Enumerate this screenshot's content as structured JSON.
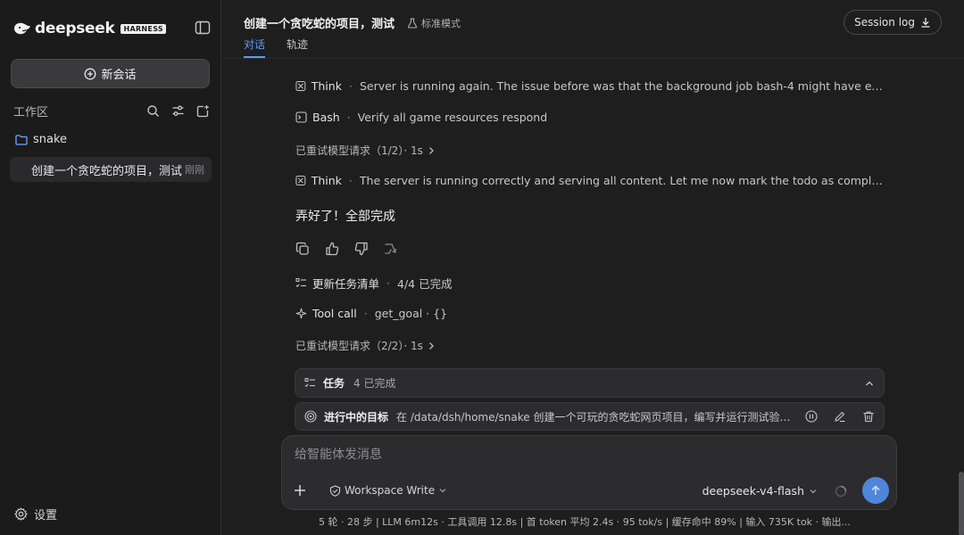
{
  "sidebar": {
    "logo_text": "deepseek",
    "logo_badge": "HARNESS",
    "new_chat_label": "新会话",
    "workspace_label": "工作区",
    "folder_name": "snake",
    "conversation": {
      "title": "创建一个贪吃蛇的项目，测试",
      "time": "刚刚"
    },
    "settings_label": "设置"
  },
  "header": {
    "title": "创建一个贪吃蛇的项目，测试",
    "mode": "标准模式",
    "tabs": [
      {
        "label": "对话"
      },
      {
        "label": "轨迹"
      }
    ],
    "session_log_label": "Session log"
  },
  "messages": {
    "steps": [
      {
        "name": "Think",
        "desc": "Server is running again. The issue before was that the background job bash-4 might have exited beca..."
      },
      {
        "name": "Bash",
        "desc": "Verify all game resources respond"
      },
      {
        "retry": "已重试模型请求（1/2）· 1s"
      },
      {
        "name": "Think",
        "desc": "The server is running correctly and serving all content. Let me now mark the todo as complete and up..."
      }
    ],
    "done_message": "弄好了！全部完成",
    "todo_update": {
      "name": "更新任务清单",
      "desc": "4/4 已完成"
    },
    "tool_call": {
      "name": "Tool call",
      "desc": "get_goal · {}"
    },
    "retry2": "已重试模型请求（2/2）· 1s"
  },
  "task_panel": {
    "label": "任务",
    "count": "4 已完成"
  },
  "goal_panel": {
    "label": "进行中的目标",
    "text": "在 /data/dsh/home/snake 创建一个可玩的贪吃蛇网页项目，编写并运行测试验证游戏..."
  },
  "composer": {
    "placeholder": "给智能体发消息",
    "workspace_mode": "Workspace Write",
    "model": "deepseek-v4-flash"
  },
  "stats": "5 轮 · 28 步  |  LLM 6m12s · 工具调用 12.8s  |  首 token 平均 2.4s · 95 tok/s  |  缓存命中 89%  |  输入 735K tok · 输出...",
  "colors": {
    "accent": "#5b9cf5",
    "send_button": "#4f86d9",
    "background": "#1e1e1f",
    "sidebar": "#1b1b1c"
  }
}
